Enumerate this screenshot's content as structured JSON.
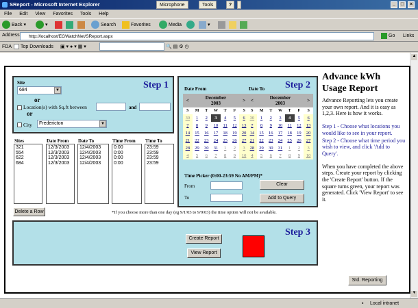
{
  "window": {
    "title": "SReport - Microsoft Internet Explorer",
    "mic": "Microphone",
    "tools": "Tools",
    "help": "?"
  },
  "menu": [
    "File",
    "Edit",
    "View",
    "Favorites",
    "Tools",
    "Help"
  ],
  "toolbar": {
    "back": "Back",
    "search": "Search",
    "favorites": "Favorites",
    "media": "Media"
  },
  "address": {
    "label": "Address",
    "url": "http://localhost/EGWatchNet/SReport.aspx",
    "go": "Go",
    "links": "Links"
  },
  "fda": {
    "label": "FDA",
    "downloads": "Top Downloads"
  },
  "step1": {
    "title": "Step 1",
    "site_label": "Site",
    "site_value": "684",
    "or1": "or",
    "locations_label": "Location(s) with Sq.ft between",
    "and": "and",
    "or2": "or",
    "city_label": "City",
    "city_value": "Fredericton"
  },
  "table": {
    "headers": [
      "Sites",
      "Date From",
      "Date To",
      "Time From",
      "Time To"
    ],
    "sites": [
      "321",
      "554",
      "622",
      "684"
    ],
    "date_from": [
      "12/3/2003",
      "12/3/2003",
      "12/3/2003",
      "12/3/2003"
    ],
    "date_to": [
      "12/4/2003",
      "12/4/2003",
      "12/4/2003",
      "12/4/2003"
    ],
    "time_from": [
      "0:00",
      "0:00",
      "0:00",
      "0:00"
    ],
    "time_to": [
      "23:59",
      "23:59",
      "23:59",
      "23:59"
    ]
  },
  "delete_button": "Delete a Row",
  "note": "*If you choose more than one day (eg 9/1/03 to 9/9/03) the time option will not be available.",
  "step2": {
    "title": "Step 2",
    "date_from_label": "Date From",
    "date_to_label": "Date To",
    "time_picker": "Time Picker (0:00-23:59 No AM/PM)*",
    "from": "From",
    "to": "To",
    "clear": "Clear",
    "add": "Add to Query"
  },
  "calendar": {
    "month": "December",
    "year": "2003",
    "prev": "<",
    "next": ">",
    "dow": [
      "S",
      "M",
      "T",
      "W",
      "T",
      "F",
      "S"
    ],
    "weeks": [
      [
        "30",
        "1",
        "2",
        "3",
        "4",
        "5",
        "6"
      ],
      [
        "7",
        "8",
        "9",
        "10",
        "11",
        "12",
        "13"
      ],
      [
        "14",
        "15",
        "16",
        "17",
        "18",
        "19",
        "20"
      ],
      [
        "21",
        "22",
        "23",
        "24",
        "25",
        "26",
        "27"
      ],
      [
        "28",
        "29",
        "30",
        "31",
        "1",
        "2",
        "3"
      ],
      [
        "4",
        "5",
        "6",
        "7",
        "8",
        "9",
        "10"
      ]
    ],
    "from_selected": "3",
    "to_selected": "4"
  },
  "step3": {
    "title": "Step 3",
    "create": "Create Report",
    "view": "View Report",
    "status_color": "#ff0000"
  },
  "info": {
    "title": "Advance kWh Usage Report",
    "intro": "Advance Reporting lets you create your own report. And it is easy as 1,2,3. Here is how it works.",
    "s1": "Step 1 - Choose what locations you would like to see in your report.",
    "s2": "Step 2 - Choose what time period you wish to view, and click 'Add to Query'.",
    "done": "When you have completed the above steps. Create your report by clicking the 'Create Report' button. If the square turns green, your report was generated. Click 'View Report' to see it.",
    "std": "Std. Reporting"
  },
  "status": {
    "zone": "Local intranet"
  }
}
